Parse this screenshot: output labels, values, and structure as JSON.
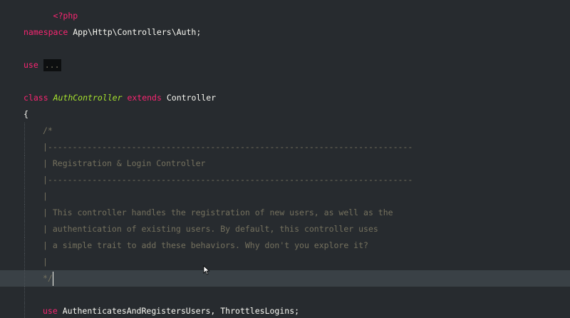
{
  "editor": {
    "colors": {
      "background": "#272b2f",
      "current_line": "#3a4146",
      "keyword": "#f92672",
      "class_name": "#a6e22e",
      "text": "#f8f8f2",
      "comment": "#75715e"
    },
    "lines": {
      "php_open": "<?php",
      "namespace_kw": "namespace",
      "namespace_path": " App\\Http\\Controllers\\Auth;",
      "use_kw": "use",
      "use_fold": "...",
      "class_kw": "class",
      "class_name": "AuthController",
      "extends_kw": "extends",
      "parent_class": "Controller",
      "open_brace": "{",
      "comment_open": "/*",
      "comment_rule_1": "|--------------------------------------------------------------------------",
      "comment_title": "| Registration & Login Controller",
      "comment_rule_2": "|--------------------------------------------------------------------------",
      "comment_blank_1": "|",
      "comment_desc_1": "| This controller handles the registration of new users, as well as the",
      "comment_desc_2": "| authentication of existing users. By default, this controller uses",
      "comment_desc_3": "| a simple trait to add these behaviors. Why don't you explore it?",
      "comment_blank_2": "|",
      "comment_close": "*/",
      "trait_use_kw": "use",
      "trait_names": " AuthenticatesAndRegistersUsers, ThrottlesLogins;"
    },
    "current_line_index": 16,
    "mouse_cursor_icon": "ibeam-cursor-icon"
  }
}
